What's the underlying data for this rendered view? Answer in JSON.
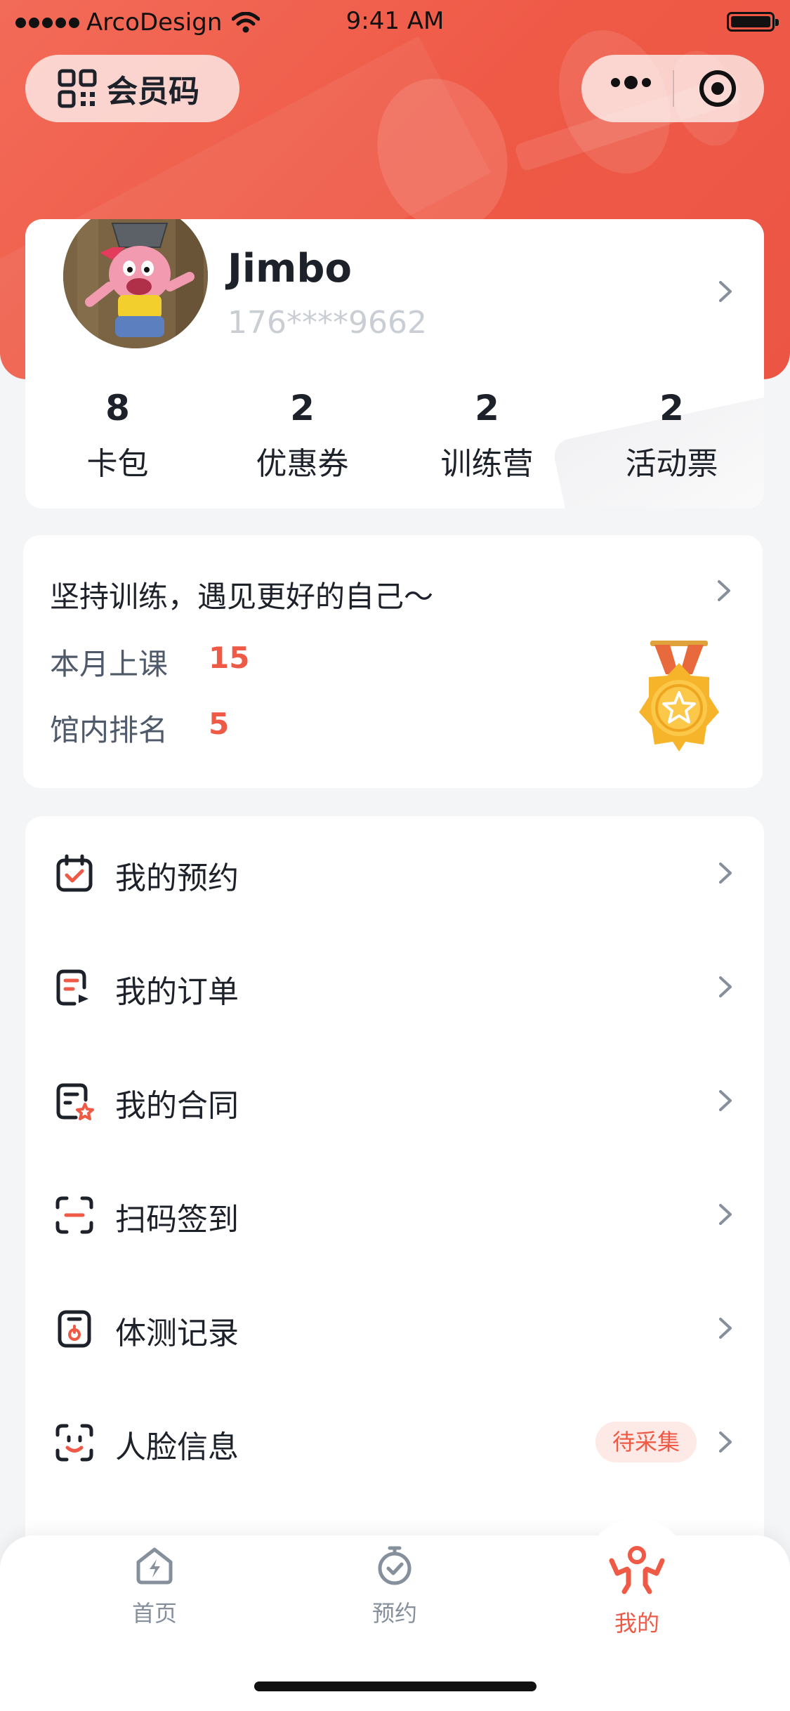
{
  "status_bar": {
    "carrier": "ArcoDesign",
    "time": "9:41 AM"
  },
  "header": {
    "member_code_label": "会员码"
  },
  "profile": {
    "name": "Jimbo",
    "phone": "176****9662",
    "stats": [
      {
        "value": "8",
        "label": "卡包"
      },
      {
        "value": "2",
        "label": "优惠券"
      },
      {
        "value": "2",
        "label": "训练营"
      },
      {
        "value": "2",
        "label": "活动票"
      }
    ]
  },
  "training": {
    "motto": "坚持训练，遇见更好的自己～",
    "monthly_classes_label": "本月上课",
    "monthly_classes_value": "15",
    "rank_label": "馆内排名",
    "rank_value": "5"
  },
  "menu": {
    "items": [
      {
        "label": "我的预约",
        "icon": "calendar-check-icon"
      },
      {
        "label": "我的订单",
        "icon": "order-icon"
      },
      {
        "label": "我的合同",
        "icon": "contract-icon"
      },
      {
        "label": "扫码签到",
        "icon": "scan-icon"
      },
      {
        "label": "体测记录",
        "icon": "body-test-icon"
      },
      {
        "label": "人脸信息",
        "icon": "face-icon",
        "badge": "待采集"
      }
    ]
  },
  "tabbar": {
    "tabs": [
      {
        "label": "首页",
        "icon": "home-icon",
        "active": false
      },
      {
        "label": "预约",
        "icon": "stopwatch-icon",
        "active": false
      },
      {
        "label": "我的",
        "icon": "person-icon",
        "active": true
      }
    ]
  },
  "colors": {
    "accent": "#ef5a47",
    "text": "#1d2129",
    "muted": "#86909c"
  }
}
